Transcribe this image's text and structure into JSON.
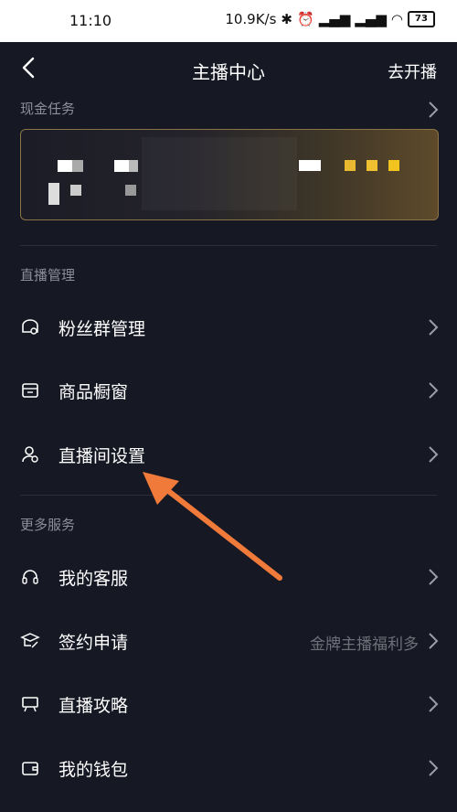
{
  "status": {
    "time": "11:10",
    "speed": "10.9K/s",
    "battery": "73"
  },
  "nav": {
    "title": "主播中心",
    "right_action": "去开播"
  },
  "cash_tasks": {
    "label": "现金任务"
  },
  "live_management": {
    "label": "直播管理",
    "items": [
      {
        "label": "粉丝群管理",
        "icon": "fan-group-icon"
      },
      {
        "label": "商品橱窗",
        "icon": "store-icon"
      },
      {
        "label": "直播间设置",
        "icon": "user-settings-icon"
      }
    ]
  },
  "more_services": {
    "label": "更多服务",
    "items": [
      {
        "label": "我的客服",
        "icon": "headset-icon",
        "extra": ""
      },
      {
        "label": "签约申请",
        "icon": "graduation-cap-icon",
        "extra": "金牌主播福利多"
      },
      {
        "label": "直播攻略",
        "icon": "presentation-board-icon",
        "extra": ""
      },
      {
        "label": "我的钱包",
        "icon": "wallet-icon",
        "extra": ""
      }
    ]
  },
  "colors": {
    "background": "#161824",
    "accent_arrow": "#f07a3a",
    "muted_text": "#8c8e99"
  }
}
